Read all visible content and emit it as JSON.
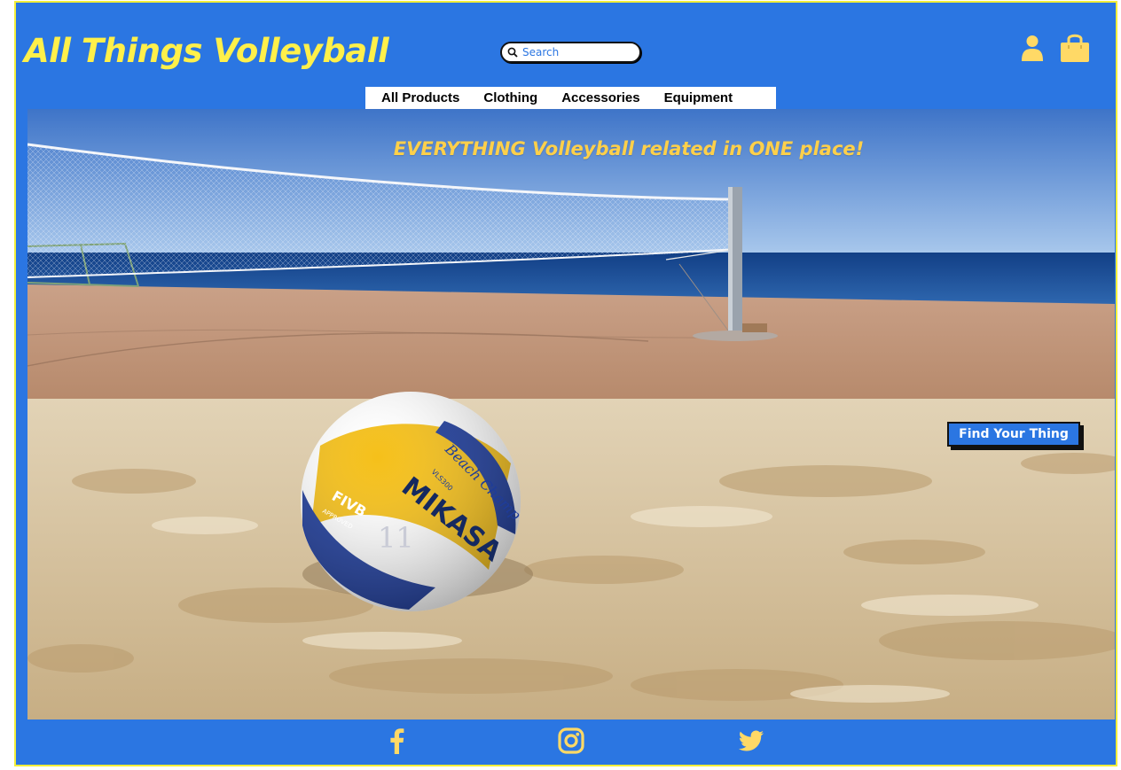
{
  "header": {
    "site_title": "All Things Volleyball",
    "search_placeholder": "Search"
  },
  "nav": {
    "items": [
      {
        "label": "All Products"
      },
      {
        "label": "Clothing"
      },
      {
        "label": "Accessories"
      },
      {
        "label": "Equipment"
      }
    ]
  },
  "hero": {
    "tagline": "EVERYTHING Volleyball related in ONE place!",
    "cta_label": "Find Your Thing",
    "ball_text": {
      "brand": "MIKASA",
      "script": "Beach Champ",
      "model": "VLS300",
      "badge": "FIVB",
      "badge_sub": "APPROVED",
      "number": "11"
    }
  },
  "footer": {
    "social_icons": [
      "facebook-icon",
      "instagram-icon",
      "twitter-icon"
    ]
  },
  "colors": {
    "page_bg": "#2b76e2",
    "title_yellow": "#fff04a",
    "icon_yellow": "#ffd966",
    "border_yellow": "#f2ee3a",
    "cta_bg": "#2b76e2"
  }
}
